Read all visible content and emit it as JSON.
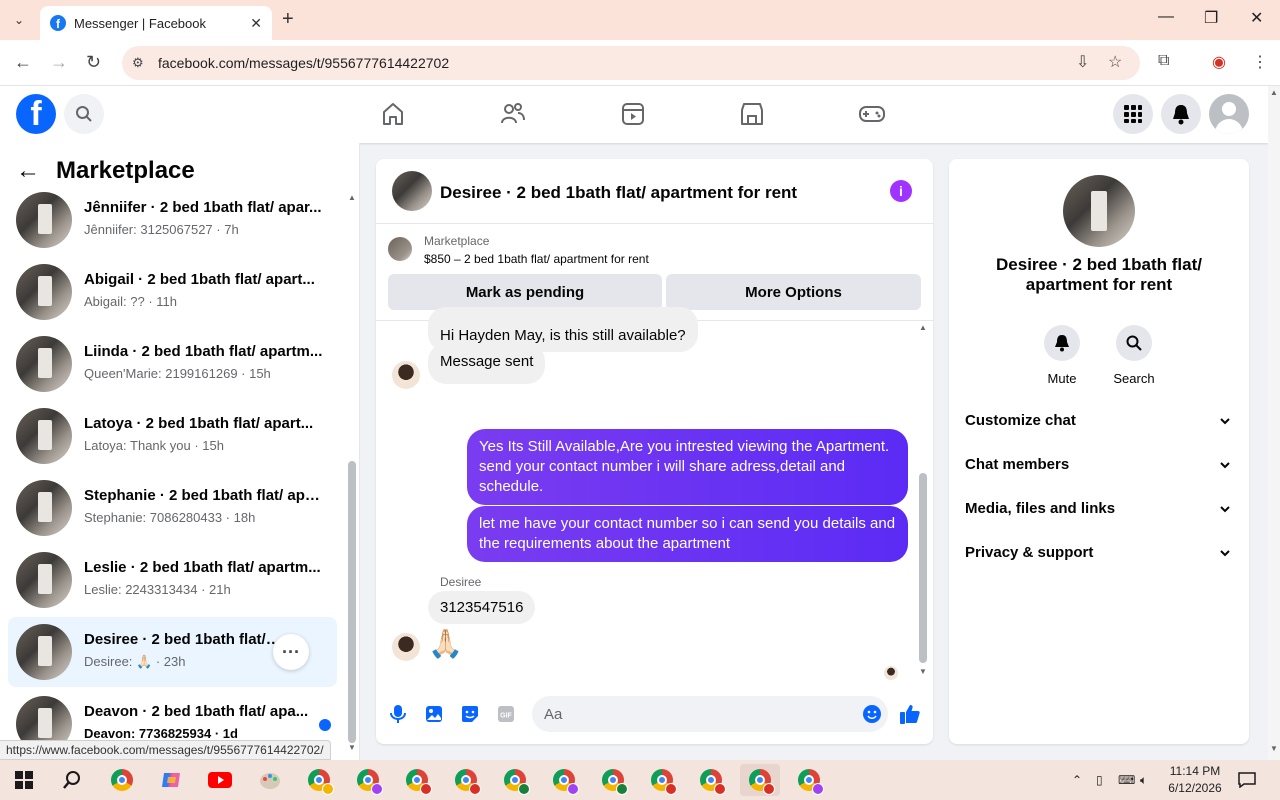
{
  "browser": {
    "tab_title": "Messenger | Facebook",
    "url": "facebook.com/messages/t/9556777614422702",
    "status_url": "https://www.facebook.com/messages/t/9556777614422702/"
  },
  "left_panel": {
    "title": "Marketplace",
    "conversations": [
      {
        "name": "Jênniifer · 2 bed 1bath flat/ apar...",
        "preview": "Jênniifer: 3125067527 · 7h"
      },
      {
        "name": "Abigail · 2 bed 1bath flat/ apart...",
        "preview": "Abigail: ?? · 11h"
      },
      {
        "name": "Liinda · 2 bed 1bath flat/ apartm...",
        "preview": "Queen'Marie: 2199161269 · 15h"
      },
      {
        "name": "Latoya · 2 bed 1bath flat/ apart...",
        "preview": "Latoya: Thank you · 15h"
      },
      {
        "name": "Stephanie · 2 bed 1bath flat/ apa...",
        "preview": "Stephanie: 7086280433 · 18h"
      },
      {
        "name": "Leslie · 2 bed 1bath flat/ apartm...",
        "preview": "Leslie: 2243313434 · 21h"
      },
      {
        "name": "Desiree · 2 bed 1bath flat/ ap...",
        "preview": "Desiree: 🙏🏻 · 23h"
      },
      {
        "name": "Deavon · 2 bed 1bath flat/ apa...",
        "preview": "Deavon: 7736825934 · 1d"
      }
    ]
  },
  "chat": {
    "title": "Desiree · 2 bed 1bath flat/ apartment for rent",
    "marketplace_label": "Marketplace",
    "listing": "$850 – 2 bed 1bath flat/ apartment for rent",
    "btn_pending": "Mark as pending",
    "btn_more": "More Options",
    "messages": {
      "m1": "Hi Hayden May, is this still available?",
      "m2": "Message sent",
      "m3": "Yes Its Still Available,Are you intrested viewing the Apartment. send your contact number i will share adress,detail and schedule.",
      "m4": "let me have your contact number so i can send you details and the requirements about the apartment",
      "sender": "Desiree",
      "m5": "3123547516",
      "m6": "🙏🏻"
    },
    "composer_placeholder": "Aa"
  },
  "right_panel": {
    "name": "Desiree · 2 bed 1bath flat/ apartment for rent",
    "mute": "Mute",
    "search": "Search",
    "sections": [
      "Customize chat",
      "Chat members",
      "Media, files and links",
      "Privacy & support"
    ]
  },
  "taskbar": {
    "time": "11:14 PM",
    "date": "6/12/2026"
  },
  "colors": {
    "fb_blue": "#0866ff",
    "messenger_purple": "#7a3cf0",
    "info_purple": "#a033ff"
  }
}
